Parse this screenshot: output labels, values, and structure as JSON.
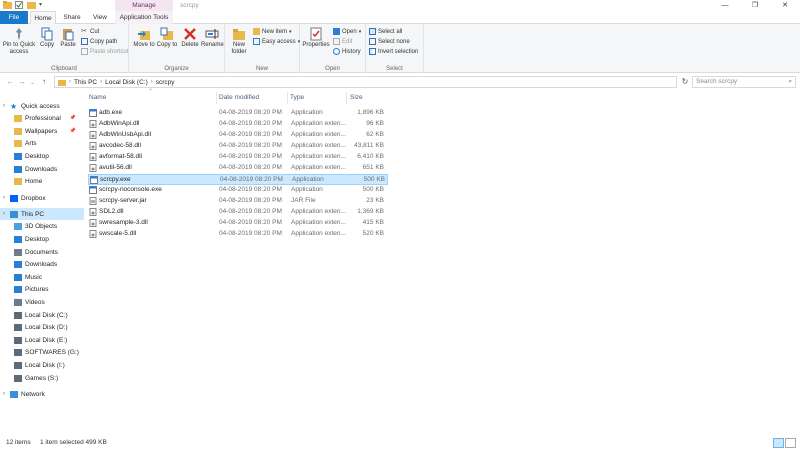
{
  "window": {
    "title": "scrcpy",
    "context_tab": "Manage",
    "controls": [
      "—",
      "❐",
      "✕"
    ]
  },
  "ribbon_tabs": {
    "file": "File",
    "home": "Home",
    "share": "Share",
    "view": "View",
    "app_tools": "Application Tools"
  },
  "ribbon": {
    "clipboard": {
      "label": "Clipboard",
      "pin": "Pin to Quick access",
      "copy": "Copy",
      "paste": "Paste",
      "cut": "Cut",
      "copy_path": "Copy path",
      "paste_shortcut": "Paste shortcut"
    },
    "organize": {
      "label": "Organize",
      "move_to": "Move to",
      "copy_to": "Copy to",
      "delete": "Delete",
      "rename": "Rename"
    },
    "new": {
      "label": "New",
      "new_folder": "New folder",
      "new_item": "New item",
      "easy_access": "Easy access"
    },
    "open": {
      "label": "Open",
      "properties": "Properties",
      "open": "Open",
      "edit": "Edit",
      "history": "History"
    },
    "select": {
      "label": "Select",
      "select_all": "Select all",
      "select_none": "Select none",
      "invert": "Invert selection"
    }
  },
  "address": {
    "crumbs": [
      "This PC",
      "Local Disk (C:)",
      "scrcpy"
    ],
    "search_placeholder": "Search scrcpy"
  },
  "columns": {
    "name": "Name",
    "date": "Date modified",
    "type": "Type",
    "size": "Size"
  },
  "files": [
    {
      "name": "adb.exe",
      "date": "04-08-2019 08:20 PM",
      "type": "Application",
      "size": "1,896 KB",
      "icon": "exe"
    },
    {
      "name": "AdbWinApi.dll",
      "date": "04-08-2019 08:20 PM",
      "type": "Application exten...",
      "size": "96 KB",
      "icon": "dll"
    },
    {
      "name": "AdbWinUsbApi.dll",
      "date": "04-08-2019 08:20 PM",
      "type": "Application exten...",
      "size": "62 KB",
      "icon": "dll"
    },
    {
      "name": "avcodec-58.dll",
      "date": "04-08-2019 08:20 PM",
      "type": "Application exten...",
      "size": "43,811 KB",
      "icon": "dll"
    },
    {
      "name": "avformat-58.dll",
      "date": "04-08-2019 08:20 PM",
      "type": "Application exten...",
      "size": "6,410 KB",
      "icon": "dll"
    },
    {
      "name": "avutil-56.dll",
      "date": "04-08-2019 08:20 PM",
      "type": "Application exten...",
      "size": "651 KB",
      "icon": "dll"
    },
    {
      "name": "scrcpy.exe",
      "date": "04-08-2019 08:20 PM",
      "type": "Application",
      "size": "500 KB",
      "icon": "exe",
      "selected": true
    },
    {
      "name": "scrcpy-noconsole.exe",
      "date": "04-08-2019 08:20 PM",
      "type": "Application",
      "size": "500 KB",
      "icon": "exe"
    },
    {
      "name": "scrcpy-server.jar",
      "date": "04-08-2019 08:20 PM",
      "type": "JAR File",
      "size": "23 KB",
      "icon": "jar"
    },
    {
      "name": "SDL2.dll",
      "date": "04-08-2019 08:20 PM",
      "type": "Application exten...",
      "size": "1,369 KB",
      "icon": "dll"
    },
    {
      "name": "swresample-3.dll",
      "date": "04-08-2019 08:20 PM",
      "type": "Application exten...",
      "size": "415 KB",
      "icon": "dll"
    },
    {
      "name": "swscale-5.dll",
      "date": "04-08-2019 08:20 PM",
      "type": "Application exten...",
      "size": "520 KB",
      "icon": "dll"
    }
  ],
  "nav": [
    {
      "label": "Quick access",
      "icon": "star-icon",
      "color": "#1979ca",
      "level": 0
    },
    {
      "label": "Professional",
      "icon": "folder-icon",
      "color": "#e8b84a",
      "level": 1,
      "pinned": true
    },
    {
      "label": "Wallpapers",
      "icon": "folder-icon",
      "color": "#e8b84a",
      "level": 1,
      "pinned": true
    },
    {
      "label": "Arts",
      "icon": "folder-icon",
      "color": "#e8b84a",
      "level": 1
    },
    {
      "label": "Desktop",
      "icon": "desktop-icon",
      "color": "#2b7ed6",
      "level": 1
    },
    {
      "label": "Downloads",
      "icon": "download-icon",
      "color": "#2b7ed6",
      "level": 1
    },
    {
      "label": "Home",
      "icon": "folder-icon",
      "color": "#e8b84a",
      "level": 1
    },
    {
      "label": "Dropbox",
      "icon": "dropbox-icon",
      "color": "#0061fe",
      "level": 0
    },
    {
      "label": "This PC",
      "icon": "computer-icon",
      "color": "#3a8fd6",
      "level": 0,
      "selected": true
    },
    {
      "label": "3D Objects",
      "icon": "cube-icon",
      "color": "#4aa3df",
      "level": 1
    },
    {
      "label": "Desktop",
      "icon": "desktop-icon",
      "color": "#2b7ed6",
      "level": 1
    },
    {
      "label": "Documents",
      "icon": "document-icon",
      "color": "#6d7b8a",
      "level": 1
    },
    {
      "label": "Downloads",
      "icon": "download-icon",
      "color": "#2b7ed6",
      "level": 1
    },
    {
      "label": "Music",
      "icon": "music-icon",
      "color": "#2b7ed6",
      "level": 1
    },
    {
      "label": "Pictures",
      "icon": "picture-icon",
      "color": "#2b7ed6",
      "level": 1
    },
    {
      "label": "Videos",
      "icon": "video-icon",
      "color": "#6d7b8a",
      "level": 1
    },
    {
      "label": "Local Disk (C:)",
      "icon": "drive-icon",
      "color": "#5a6b7b",
      "level": 1
    },
    {
      "label": "Local Disk (D:)",
      "icon": "drive-icon",
      "color": "#5a6b7b",
      "level": 1
    },
    {
      "label": "Local Disk (E:)",
      "icon": "drive-icon",
      "color": "#5a6b7b",
      "level": 1
    },
    {
      "label": "SOFTWARES (G:)",
      "icon": "drive-icon",
      "color": "#5a6b7b",
      "level": 1
    },
    {
      "label": "Local Disk (I:)",
      "icon": "drive-icon",
      "color": "#5a6b7b",
      "level": 1
    },
    {
      "label": "Games (S:)",
      "icon": "drive-icon",
      "color": "#5a6b7b",
      "level": 1
    },
    {
      "label": "Network",
      "icon": "network-icon",
      "color": "#3a8fd6",
      "level": 0
    }
  ],
  "status": {
    "count": "12 items",
    "selection": "1 item selected  499 KB"
  }
}
